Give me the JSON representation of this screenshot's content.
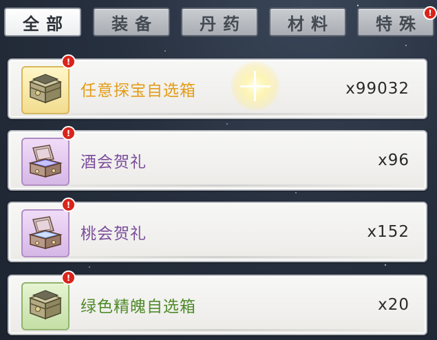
{
  "tabs": [
    {
      "label": "全部",
      "active": true,
      "badge": false
    },
    {
      "label": "装备",
      "active": false,
      "badge": false
    },
    {
      "label": "丹药",
      "active": false,
      "badge": false
    },
    {
      "label": "材料",
      "active": false,
      "badge": false
    },
    {
      "label": "特殊",
      "active": false,
      "badge": true
    }
  ],
  "badge_mark": "!",
  "items": [
    {
      "name": "任意探宝自选箱",
      "count": "x99032",
      "rarity": "gold",
      "name_color": "#e49c16",
      "icon": "golden-chest-icon"
    },
    {
      "name": "酒会贺礼",
      "count": "x96",
      "rarity": "purple",
      "name_color": "#7b4c9c",
      "icon": "open-gift-box-icon"
    },
    {
      "name": "桃会贺礼",
      "count": "x152",
      "rarity": "purple",
      "name_color": "#7b4c9c",
      "icon": "open-gift-box-icon"
    },
    {
      "name": "绿色精魄自选箱",
      "count": "x20",
      "rarity": "green",
      "name_color": "#4f8a28",
      "icon": "golden-chest-icon"
    }
  ]
}
